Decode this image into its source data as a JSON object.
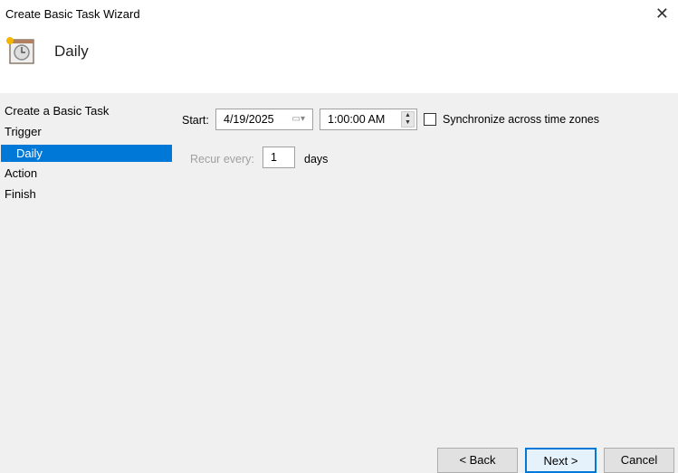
{
  "window": {
    "title": "Create Basic Task Wizard",
    "close_icon": "close-icon"
  },
  "header": {
    "title": "Daily",
    "icon": "task-scheduler-clock-icon"
  },
  "steps": [
    {
      "label": "Create a Basic Task"
    },
    {
      "label": "Trigger"
    },
    {
      "label": "Daily",
      "selected": true
    },
    {
      "label": "Action"
    },
    {
      "label": "Finish"
    }
  ],
  "form": {
    "start_label": "Start:",
    "start_date": "4/19/2025",
    "start_time": "1:00:00 AM",
    "sync_label": "Synchronize across time zones",
    "sync_checked": false,
    "recur_label": "Recur every:",
    "recur_value": "1",
    "recur_unit": "days"
  },
  "buttons": {
    "back": "< Back",
    "next": "Next >",
    "cancel": "Cancel"
  },
  "colors": {
    "accent": "#0078d7"
  }
}
